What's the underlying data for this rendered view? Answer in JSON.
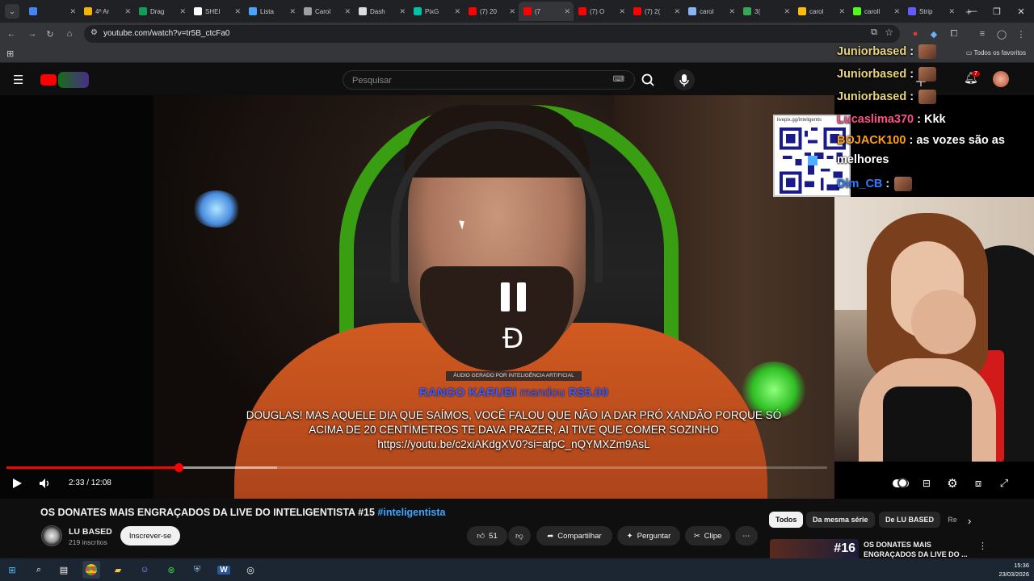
{
  "browser": {
    "tabs": [
      {
        "title": "",
        "icon": "diamond-icon",
        "color": "#4285f4"
      },
      {
        "title": "4º Ar",
        "icon": "drive-icon",
        "color": "#f4b400"
      },
      {
        "title": "Drag",
        "icon": "drive-icon",
        "color": "#0f9d58"
      },
      {
        "title": "SHEI",
        "icon": "shein-icon",
        "color": "#ffffff"
      },
      {
        "title": "Lista",
        "icon": "cloud-icon",
        "color": "#4aa3ff"
      },
      {
        "title": "Carol",
        "icon": "globe-icon",
        "color": "#9aa0a6"
      },
      {
        "title": "Dash",
        "icon": "globe-icon",
        "color": "#dddddd"
      },
      {
        "title": "PixG",
        "icon": "eye-icon",
        "color": "#00c2a8"
      },
      {
        "title": "(7) 20",
        "icon": "youtube-icon",
        "color": "#ff0000"
      },
      {
        "title": "(7",
        "icon": "youtube-icon",
        "color": "#ff0000",
        "active": true
      },
      {
        "title": "(7) O",
        "icon": "youtube-icon",
        "color": "#ff0000"
      },
      {
        "title": "(7) 2(",
        "icon": "youtube-icon",
        "color": "#ff0000"
      },
      {
        "title": "carol",
        "icon": "doc-icon",
        "color": "#8ab4f8"
      },
      {
        "title": "3(",
        "icon": "sheet-icon",
        "color": "#34a853"
      },
      {
        "title": "carol",
        "icon": "globe-icon",
        "color": "#fbbc04"
      },
      {
        "title": "caroll",
        "icon": "k-icon",
        "color": "#53fc18"
      },
      {
        "title": "Strip",
        "icon": "stripe-icon",
        "color": "#635bff"
      }
    ],
    "url": "youtube.com/watch?v=tr5B_ctcFa0",
    "bookmarks_all": "Todos os favoritos"
  },
  "youtube": {
    "search_placeholder": "Pesquisar",
    "notification_count": "7"
  },
  "video": {
    "tts_tag": "ÁUDIO GERADO POR INTELIGÊNCIA ARTIFICIAL",
    "donor_name": "RANGO KARUBI",
    "donor_action": "mandou",
    "donor_amount": "R$5.00",
    "donation_text": "DOUGLAS! MAS AQUELE DIA QUE SAÍMOS, VOCÊ FALOU QUE NÃO IA DAR PRÓ XANDÃO PORQUE SÓ ACIMA DE 20 CENTÍMETROS TE DAVA PRAZER, AI TIVE QUE COMER SOZINHO",
    "donation_link": "https://youtu.be/c2xiAKdgXV0?si=afpC_nQYMXZm9AsL",
    "qr_url": "livepix.gg/inteligentis",
    "chat": [
      {
        "user": "Juniorbased",
        "text": "",
        "color": "#e6d37a",
        "emote": true
      },
      {
        "user": "Juniorbased",
        "text": "",
        "color": "#e6d37a",
        "emote": true
      },
      {
        "user": "Juniorbased",
        "text": "",
        "color": "#e6d37a",
        "emote": true
      },
      {
        "user": "Lucaslima370",
        "text": "Kkk",
        "color": "#ff4f8b",
        "emote": false
      },
      {
        "user": "BOJACK100",
        "text": "as vozes são as melhores",
        "color": "#ff9f1a",
        "emote": false
      },
      {
        "user": "Dim_CB",
        "text": "",
        "color": "#2f7cff",
        "emote": true
      }
    ],
    "current_time": "2:33",
    "duration": "12:08",
    "time_display": "2:33 / 12:08",
    "progress_fraction": 0.21,
    "buffer_fraction": 0.33
  },
  "info": {
    "title": "OS DONATES MAIS ENGRAÇADOS DA LIVE DO INTELIGENTISTA #15",
    "hashtag": "#inteligentista",
    "channel": "LU BASED",
    "subscribers": "219 inscritos",
    "subscribe_label": "Inscrever-se",
    "likes": "51",
    "share_label": "Compartilhar",
    "ask_label": "Perguntar",
    "clip_label": "Clipe",
    "chips": [
      "Todos",
      "Da mesma série",
      "De LU BASED",
      "Re"
    ],
    "rec_number": "#16",
    "rec_title": "OS DONATES MAIS ENGRAÇADOS DA LIVE DO ..."
  },
  "taskbar": {
    "time": "15:36",
    "date": "23/03/2026"
  }
}
